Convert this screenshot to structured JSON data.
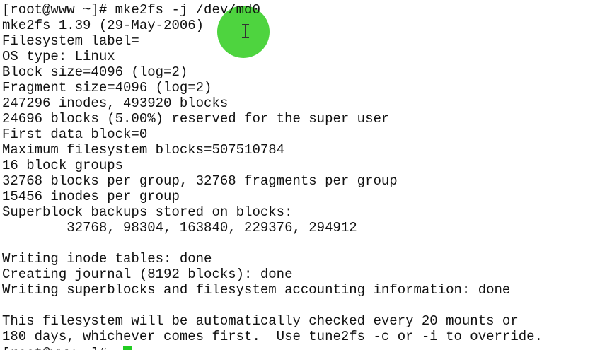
{
  "terminal": {
    "lines": [
      "[root@www ~]# mke2fs -j /dev/md0",
      "mke2fs 1.39 (29-May-2006)",
      "Filesystem label=",
      "OS type: Linux",
      "Block size=4096 (log=2)",
      "Fragment size=4096 (log=2)",
      "247296 inodes, 493920 blocks",
      "24696 blocks (5.00%) reserved for the super user",
      "First data block=0",
      "Maximum filesystem blocks=507510784",
      "16 block groups",
      "32768 blocks per group, 32768 fragments per group",
      "15456 inodes per group",
      "Superblock backups stored on blocks:",
      "        32768, 98304, 163840, 229376, 294912",
      "",
      "Writing inode tables: done",
      "Creating journal (8192 blocks): done",
      "Writing superblocks and filesystem accounting information: done",
      "",
      "This filesystem will be automatically checked every 20 mounts or",
      "180 days, whichever comes first.  Use tune2fs -c or -i to override."
    ],
    "next_prompt": "[root@www ~]# ",
    "cursor_color": "#22cc22",
    "highlight_color": "#3fd02f"
  }
}
